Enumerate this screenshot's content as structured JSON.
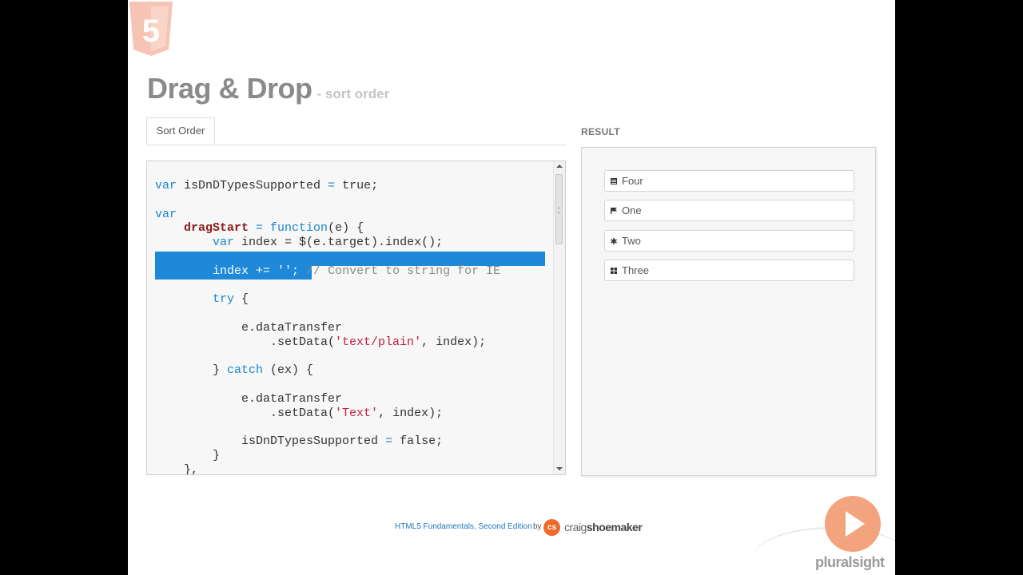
{
  "header": {
    "title": "Drag & Drop",
    "subtitle": "- sort order"
  },
  "editor": {
    "tab_label": "Sort Order",
    "lines": {
      "l1": [
        "var",
        " isDnDTypesSupported ",
        "=",
        " true;"
      ],
      "l3": "var",
      "l4": [
        "dragStart",
        " = ",
        "function",
        "(e) {"
      ],
      "l5": [
        "var",
        " index = $(e.target).index();"
      ],
      "l7": [
        "index += ",
        "''",
        "; ",
        "// Convert to string for IE"
      ],
      "l9": [
        "try",
        " {"
      ],
      "l11": "e.dataTransfer",
      "l12": [
        ".setData(",
        "'text/plain'",
        ", index);"
      ],
      "l14": [
        "} ",
        "catch",
        " (ex) {"
      ],
      "l16": "e.dataTransfer",
      "l17": [
        ".setData(",
        "'Text'",
        ", index);"
      ],
      "l19": [
        "isDnDTypesSupported ",
        "=",
        " false;"
      ],
      "l20": "}",
      "l21": "},"
    }
  },
  "result": {
    "label": "RESULT",
    "items": [
      {
        "label": "Four",
        "icon": "calendar-icon"
      },
      {
        "label": "One",
        "icon": "flag-icon"
      },
      {
        "label": "Two",
        "icon": "asterisk-icon"
      },
      {
        "label": "Three",
        "icon": "grid-icon"
      }
    ]
  },
  "footer": {
    "course": "HTML5 Fundamentals, Second Edition",
    "by": "by",
    "author_badge": "cs",
    "author_first": "craig",
    "author_last": "shoemaker"
  },
  "branding": {
    "logo_icon": "html5-shield-icon",
    "logo_glyph": "5",
    "play_icon": "play-icon",
    "brand": "pluralsight"
  },
  "colors": {
    "keyword": "#1a86c8",
    "function_name": "#8b1a1a",
    "string": "#c02040",
    "selection": "#1e88d9",
    "accent_orange": "#ee6a2a"
  }
}
